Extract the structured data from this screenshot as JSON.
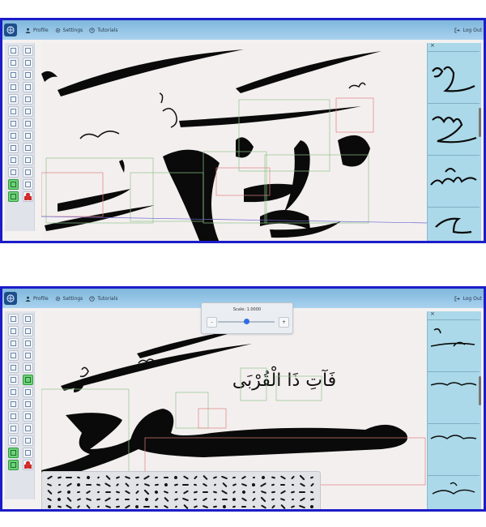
{
  "windows": [
    {
      "menu": {
        "profile": "Profile",
        "settings": "Settings",
        "tutorials": "Tutorials",
        "logout": "Log Out"
      }
    },
    {
      "menu": {
        "profile": "Profile",
        "settings": "Settings",
        "tutorials": "Tutorials",
        "logout": "Log Out"
      },
      "scale_popup": {
        "label": "Scale: 1.0000",
        "minus": "-",
        "plus": "+",
        "slider_value": 0.5
      },
      "canvas_text": "فَآتِ ذَا الْقُرْبَى"
    }
  ],
  "right_panel": {
    "close": "×"
  },
  "icons": {
    "logo": "calligraphy-logo-icon",
    "profile": "user-icon",
    "settings": "gear-icon",
    "tutorials": "help-circle-icon",
    "logout": "logout-icon"
  },
  "colors": {
    "frame": "#1c1cc8",
    "topbar": "#8cc2e6",
    "right_panel": "#abd9e9",
    "highlight_tool": "#6ed27a",
    "green_box": "#8dc48d",
    "red_box": "#e08080"
  }
}
